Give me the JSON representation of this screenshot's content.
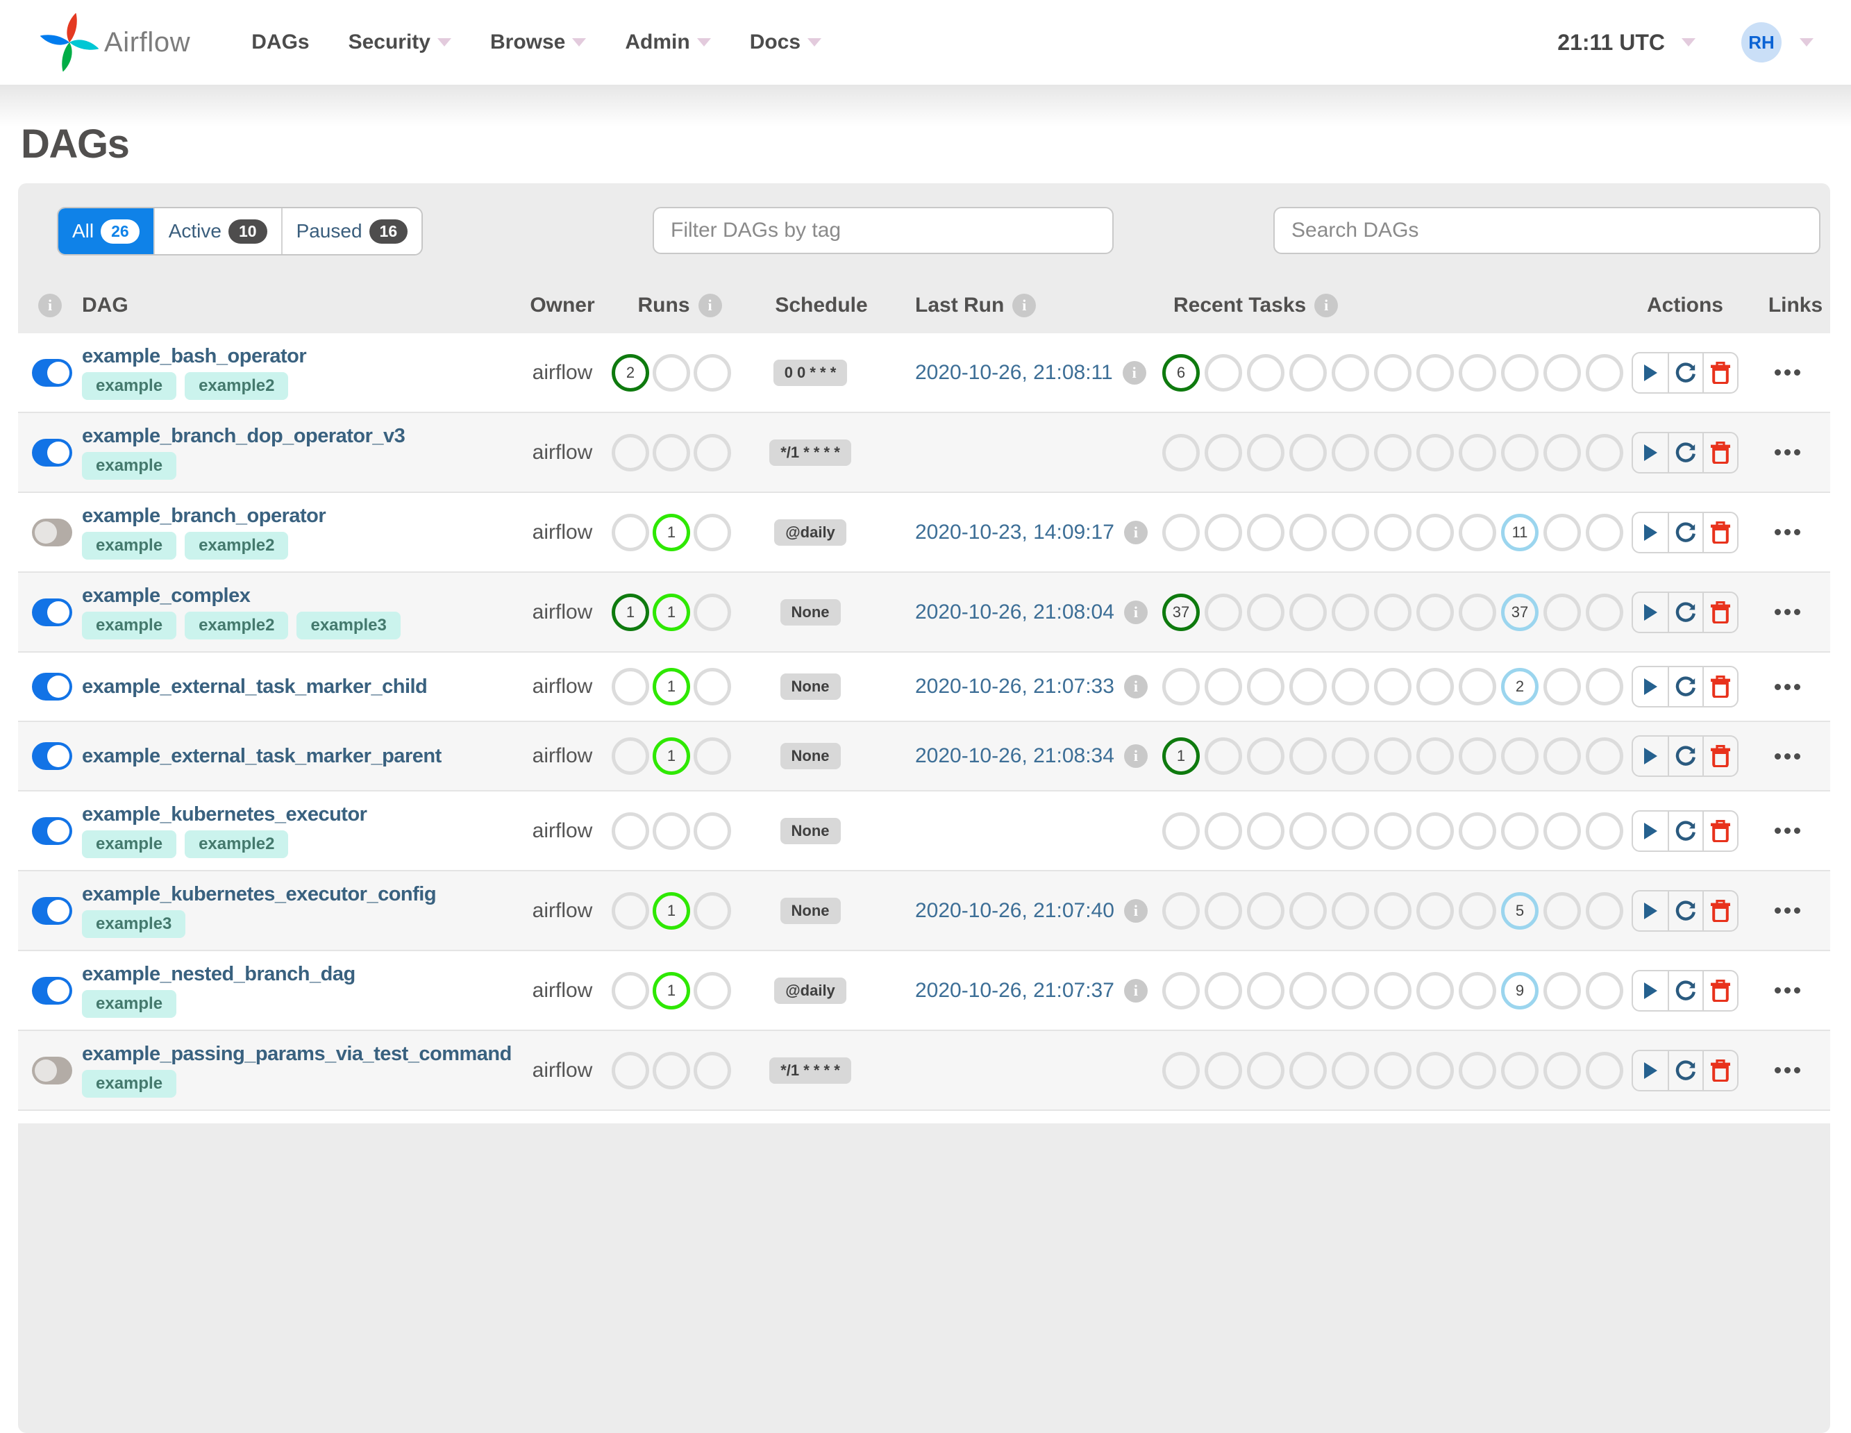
{
  "navbar": {
    "brand": "Airflow",
    "items": [
      {
        "label": "DAGs",
        "caret": false
      },
      {
        "label": "Security",
        "caret": true
      },
      {
        "label": "Browse",
        "caret": true
      },
      {
        "label": "Admin",
        "caret": true
      },
      {
        "label": "Docs",
        "caret": true
      }
    ],
    "clock": "21:11 UTC",
    "avatar": "RH"
  },
  "page_title": "DAGs",
  "tabs": [
    {
      "label": "All",
      "count": "26",
      "active": true
    },
    {
      "label": "Active",
      "count": "10",
      "active": false
    },
    {
      "label": "Paused",
      "count": "16",
      "active": false
    }
  ],
  "filters": {
    "tag_placeholder": "Filter DAGs by tag",
    "search_placeholder": "Search DAGs"
  },
  "table": {
    "columns": {
      "dag": "DAG",
      "owner": "Owner",
      "runs": "Runs",
      "schedule": "Schedule",
      "last_run": "Last Run",
      "recent_tasks": "Recent Tasks",
      "actions": "Actions",
      "links": "Links"
    },
    "runs_slots": 3,
    "recent_slots": 11,
    "rows": [
      {
        "name": "example_bash_operator",
        "enabled": true,
        "tags": [
          "example",
          "example2"
        ],
        "owner": "airflow",
        "runs": [
          {
            "slot": 0,
            "count": "2",
            "state": "success"
          }
        ],
        "schedule": "0 0 * * *",
        "last_run": "2020-10-26, 21:08:11",
        "recent": [
          {
            "slot": 0,
            "count": "6",
            "state": "success"
          }
        ]
      },
      {
        "name": "example_branch_dop_operator_v3",
        "enabled": true,
        "tags": [
          "example"
        ],
        "owner": "airflow",
        "runs": [],
        "schedule": "*/1 * * * *",
        "last_run": "",
        "recent": []
      },
      {
        "name": "example_branch_operator",
        "enabled": false,
        "tags": [
          "example",
          "example2"
        ],
        "owner": "airflow",
        "runs": [
          {
            "slot": 1,
            "count": "1",
            "state": "running"
          }
        ],
        "schedule": "@daily",
        "last_run": "2020-10-23, 14:09:17",
        "recent": [
          {
            "slot": 8,
            "count": "11",
            "state": "none"
          }
        ]
      },
      {
        "name": "example_complex",
        "enabled": true,
        "tags": [
          "example",
          "example2",
          "example3"
        ],
        "owner": "airflow",
        "runs": [
          {
            "slot": 0,
            "count": "1",
            "state": "success"
          },
          {
            "slot": 1,
            "count": "1",
            "state": "running"
          }
        ],
        "schedule": "None",
        "last_run": "2020-10-26, 21:08:04",
        "recent": [
          {
            "slot": 0,
            "count": "37",
            "state": "success"
          },
          {
            "slot": 8,
            "count": "37",
            "state": "none"
          }
        ]
      },
      {
        "name": "example_external_task_marker_child",
        "enabled": true,
        "tags": [],
        "owner": "airflow",
        "runs": [
          {
            "slot": 1,
            "count": "1",
            "state": "running"
          }
        ],
        "schedule": "None",
        "last_run": "2020-10-26, 21:07:33",
        "recent": [
          {
            "slot": 8,
            "count": "2",
            "state": "none"
          }
        ]
      },
      {
        "name": "example_external_task_marker_parent",
        "enabled": true,
        "tags": [],
        "owner": "airflow",
        "runs": [
          {
            "slot": 1,
            "count": "1",
            "state": "running"
          }
        ],
        "schedule": "None",
        "last_run": "2020-10-26, 21:08:34",
        "recent": [
          {
            "slot": 0,
            "count": "1",
            "state": "success"
          }
        ]
      },
      {
        "name": "example_kubernetes_executor",
        "enabled": true,
        "tags": [
          "example",
          "example2"
        ],
        "owner": "airflow",
        "runs": [],
        "schedule": "None",
        "last_run": "",
        "recent": []
      },
      {
        "name": "example_kubernetes_executor_config",
        "enabled": true,
        "tags": [
          "example3"
        ],
        "owner": "airflow",
        "runs": [
          {
            "slot": 1,
            "count": "1",
            "state": "running"
          }
        ],
        "schedule": "None",
        "last_run": "2020-10-26, 21:07:40",
        "recent": [
          {
            "slot": 8,
            "count": "5",
            "state": "none"
          }
        ]
      },
      {
        "name": "example_nested_branch_dag",
        "enabled": true,
        "tags": [
          "example"
        ],
        "owner": "airflow",
        "runs": [
          {
            "slot": 1,
            "count": "1",
            "state": "running"
          }
        ],
        "schedule": "@daily",
        "last_run": "2020-10-26, 21:07:37",
        "recent": [
          {
            "slot": 8,
            "count": "9",
            "state": "none"
          }
        ]
      },
      {
        "name": "example_passing_params_via_test_command",
        "enabled": false,
        "tags": [
          "example"
        ],
        "owner": "airflow",
        "runs": [],
        "schedule": "*/1 * * * *",
        "last_run": "",
        "recent": []
      }
    ]
  },
  "colors": {
    "brand_blue": "#0f82e8",
    "toggle_on": "#1273e6",
    "success": "#0e7a0e",
    "running": "#2ee800",
    "none_state": "#9bd5ee",
    "danger": "#e8321c",
    "link": "#39617f",
    "tag_bg": "#cbf3ed"
  }
}
